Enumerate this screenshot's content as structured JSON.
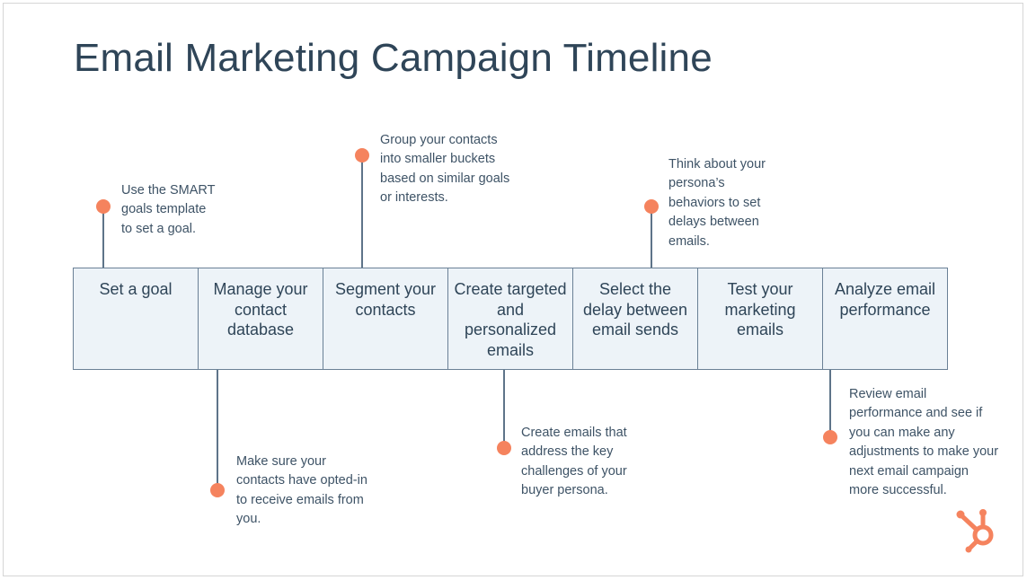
{
  "title": "Email Marketing Campaign Timeline",
  "steps": [
    {
      "label": "Set a goal"
    },
    {
      "label": "Manage your contact database"
    },
    {
      "label": "Segment your contacts"
    },
    {
      "label": "Create targeted and personalized emails"
    },
    {
      "label": "Select the delay between email sends"
    },
    {
      "label": "Test your marketing emails"
    },
    {
      "label": "Analyze email performance"
    }
  ],
  "notes": {
    "goal": "Use the SMART\ngoals template\nto set a goal.",
    "database": "Make sure your\ncontacts have opted-in\nto receive emails from\nyou.",
    "segment": "Group your contacts\ninto smaller buckets\nbased on similar goals\nor interests.",
    "targeted": "Create emails that\naddress the key\nchallenges of your\nbuyer persona.",
    "delay": "Think about your\npersona’s\nbehaviors to set\ndelays between\nemails.",
    "analyze": "Review email\nperformance and see if\nyou can make any\nadjustments to make your\nnext email campaign\nmore successful."
  },
  "colors": {
    "accent": "#f5835e",
    "box_fill": "#edf3f8",
    "text": "#2f4558"
  },
  "logo_icon": "hubspot-sprocket-icon"
}
